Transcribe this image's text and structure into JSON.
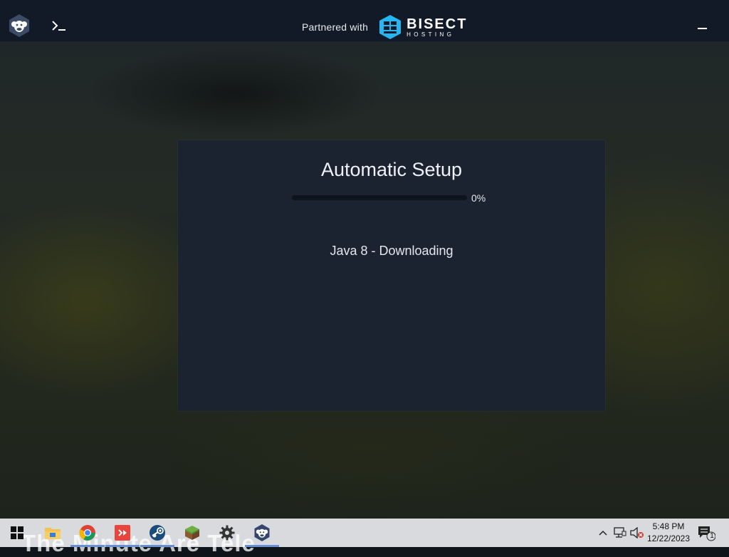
{
  "titlebar": {
    "partner_text": "Partnered with",
    "partner_brand": "BISECT",
    "partner_brand_sub": "HOSTING"
  },
  "setup": {
    "title": "Automatic Setup",
    "progress_percent": 0,
    "progress_label": "0%",
    "status": "Java 8 - Downloading"
  },
  "taskbar": {
    "watermark": "The Minute Are Tele",
    "apps": [
      "start-windows",
      "file-explorer",
      "chrome",
      "git-client",
      "steam",
      "minecraft",
      "settings",
      "minecraft-launcher"
    ],
    "clock_time": "5:48 PM",
    "clock_date": "12/22/2023",
    "notification_count": "1"
  },
  "colors": {
    "titlebar": "#121a28",
    "panel": "#1b2230",
    "accent_cyan": "#26b6f1",
    "taskbar": "#d9dadd"
  }
}
